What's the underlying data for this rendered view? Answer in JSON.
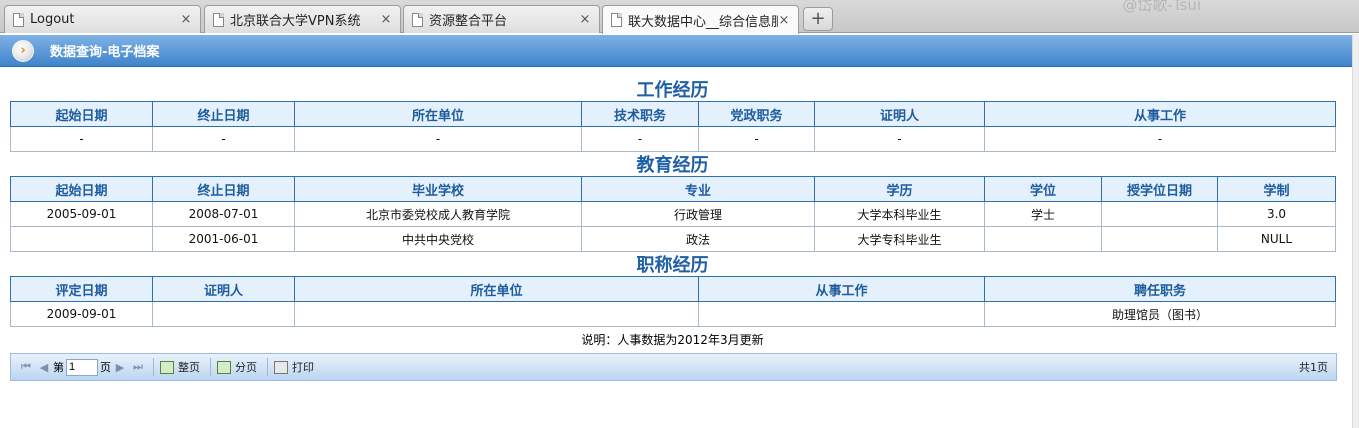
{
  "browser": {
    "tabs": [
      {
        "label": "Logout"
      },
      {
        "label": "北京联合大学VPN系统"
      },
      {
        "label": "资源整合平台"
      },
      {
        "label": "联大数据中心__综合信息服"
      }
    ],
    "new_tab": "+",
    "close_glyph": "×",
    "watermark": "@岱歌-Tsui"
  },
  "header": {
    "icon": "arrow-right-icon",
    "title": "数据查询-电子档案"
  },
  "work": {
    "title": "工作经历",
    "columns": [
      "起始日期",
      "终止日期",
      "所在单位",
      "技术职务",
      "党政职务",
      "证明人",
      "从事工作"
    ],
    "rows": [
      [
        "-",
        "-",
        "-",
        "-",
        "-",
        "-",
        "-"
      ]
    ]
  },
  "education": {
    "title": "教育经历",
    "columns": [
      "起始日期",
      "终止日期",
      "毕业学校",
      "专业",
      "学历",
      "学位",
      "授学位日期",
      "学制"
    ],
    "rows": [
      [
        "2005-09-01",
        "2008-07-01",
        "北京市委党校成人教育学院",
        "行政管理",
        "大学本科毕业生",
        "学士",
        "",
        "3.0"
      ],
      [
        "",
        "2001-06-01",
        "中共中央党校",
        "政法",
        "大学专科毕业生",
        "",
        "",
        "NULL"
      ]
    ]
  },
  "title_history": {
    "title": "职称经历",
    "columns": [
      "评定日期",
      "证明人",
      "所在单位",
      "从事工作",
      "聘任职务"
    ],
    "rows": [
      [
        "2009-09-01",
        "",
        "",
        "",
        "助理馆员（图书）"
      ]
    ]
  },
  "note": "说明：人事数据为2012年3月更新",
  "pager": {
    "first": "⏮",
    "prev": "◀",
    "next": "▶",
    "last": "⏭",
    "page_prefix": "第",
    "page_value": "1",
    "page_suffix": "页",
    "whole_page": "整页",
    "split_page": "分页",
    "print": "打印",
    "total": "共1页"
  }
}
